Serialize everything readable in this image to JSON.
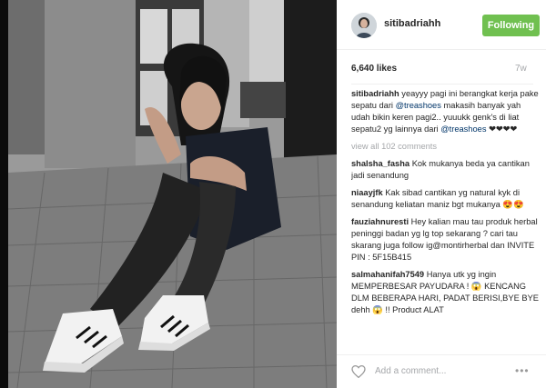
{
  "post": {
    "username": "sitibadriahh",
    "follow_label": "Following",
    "likes": "6,640 likes",
    "age": "7w"
  },
  "caption": {
    "user": "sitibadriahh",
    "text_1": "yeayyy pagi ini berangkat kerja pake sepatu dari ",
    "mention_1": "@treashoes",
    "text_2": " makasih banyak yah udah bikin keren pagi2.. yuuukk genk's di liat sepatu2 yg lainnya dari ",
    "mention_2": "@treashoes",
    "text_3": " ❤︎❤︎❤︎❤︎"
  },
  "view_all": "view all 102 comments",
  "comments": [
    {
      "user": "shalsha_fasha",
      "text": "Kok mukanya beda ya cantikan jadi senandung"
    },
    {
      "user": "niaayjfk",
      "text": "Kak sibad cantikan yg natural kyk di senandung keliatan maniz bgt mukanya 😍😍"
    },
    {
      "user": "fauziahnuresti",
      "text": "Hey kalian mau tau produk herbal peninggi badan yg lg top sekarang ? cari tau skarang juga follow ig@montirherbal dan INVITE PIN : 5F15B415"
    },
    {
      "user": "salmahanifah7549",
      "text": "Hanya utk yg ingin MEMPERBESAR PAYUDARA ! 😱 KENCANG DLM BEBERAPA HARI, PADAT BERISI,BYE BYE dehh 😱 !! Product ALAT"
    }
  ],
  "footer": {
    "placeholder": "Add a comment...",
    "more": "•••"
  },
  "icons": {
    "heart": "heart-icon",
    "more": "more-options-icon"
  },
  "colors": {
    "follow_button": "#70c050",
    "mention": "#003569",
    "muted": "#a5a7aa"
  }
}
